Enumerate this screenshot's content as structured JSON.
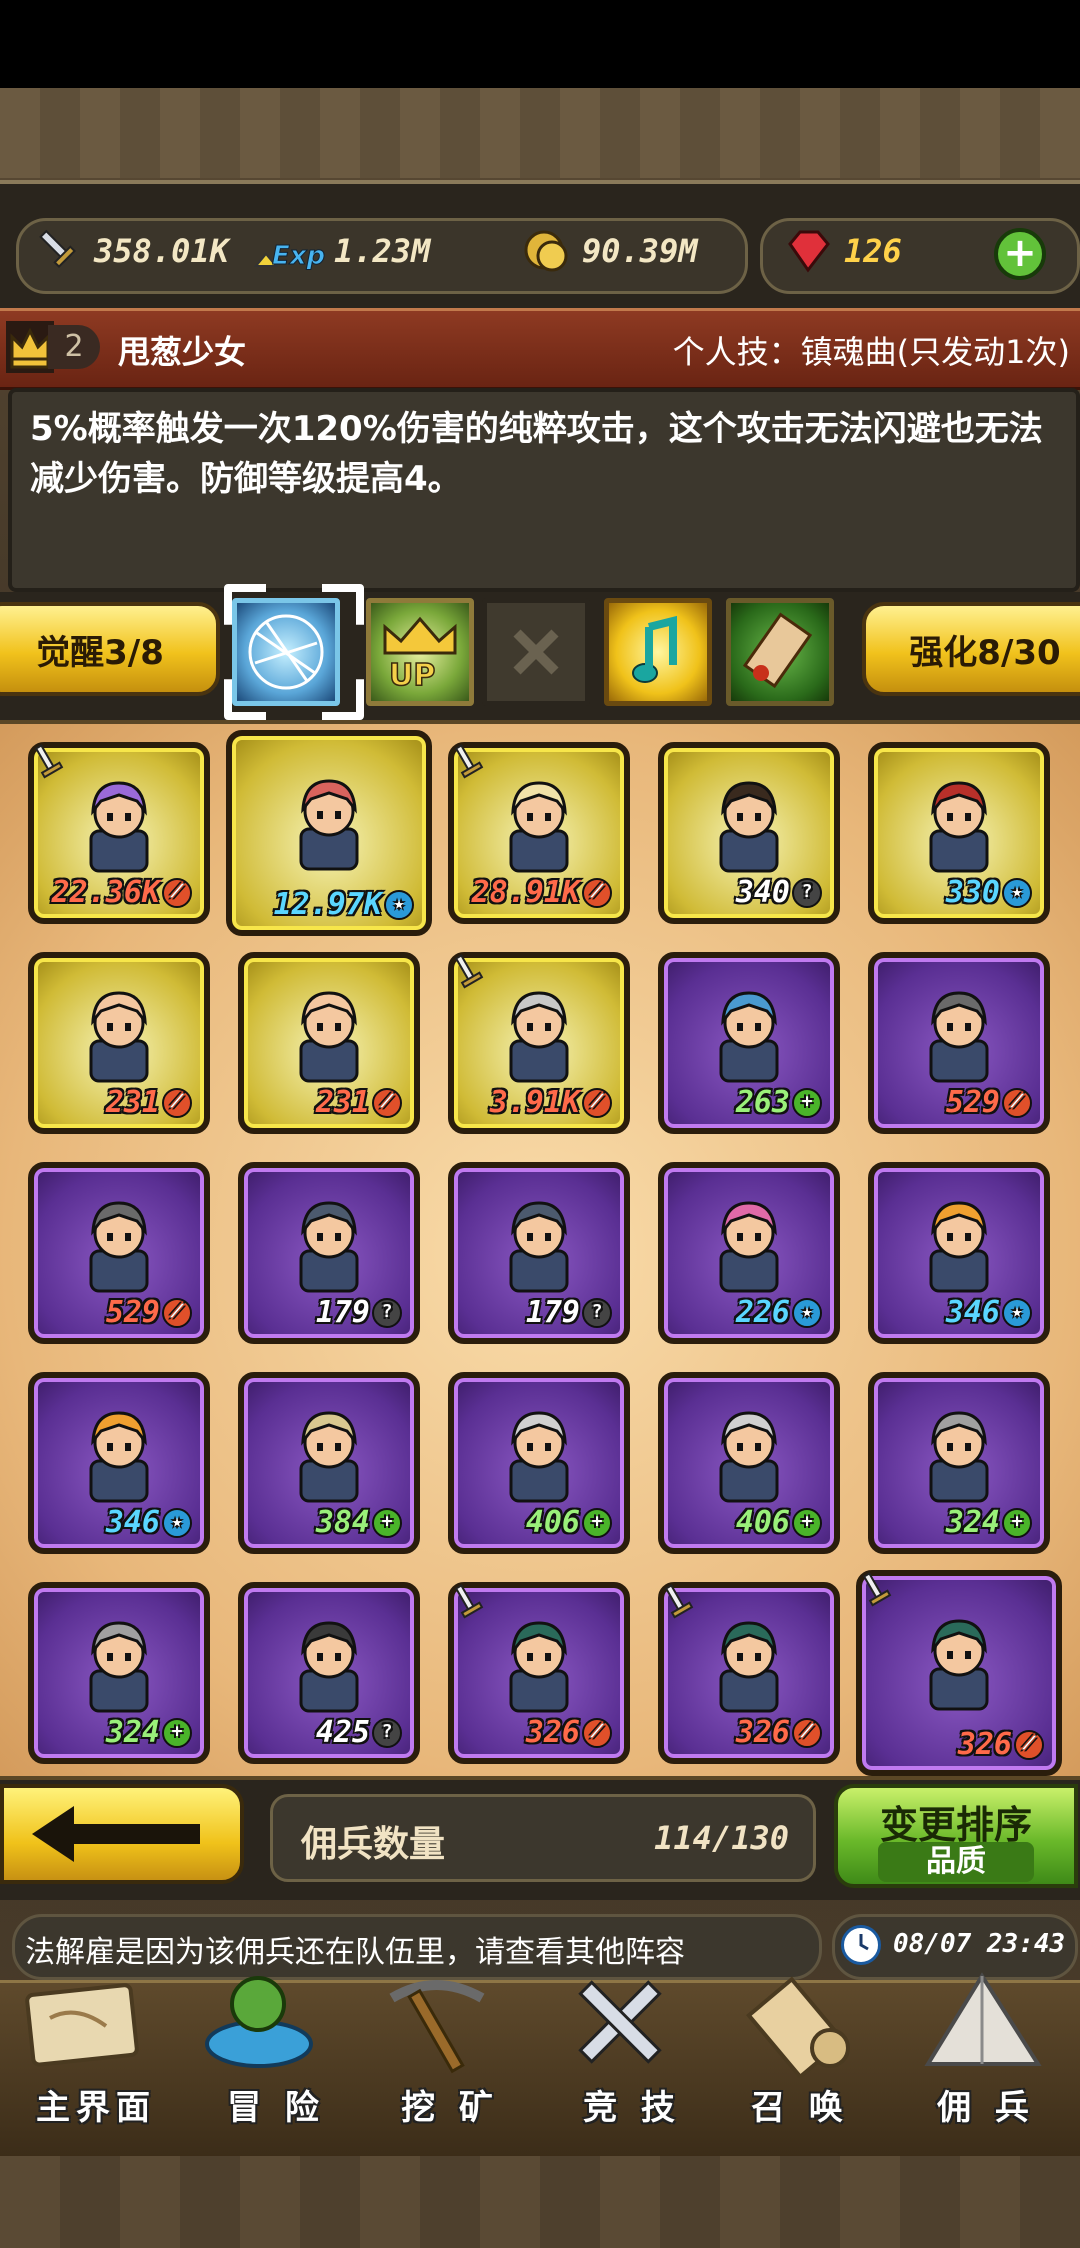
{
  "resources": {
    "attack": "358.01K",
    "exp": "1.23M",
    "gold": "90.39M",
    "gems": "126",
    "exp_badge": "Exp"
  },
  "hero": {
    "rank": "2",
    "name": "甩葱少女",
    "skill_title": "个人技：镇魂曲(只发动1次)",
    "description": "5%概率触发一次120%伤害的纯粹攻击，这个攻击无法闪避也无法减少伤害。防御等级提高4。"
  },
  "buttons": {
    "awaken": "觉醒3/8",
    "enhance": "强化8/30",
    "sort_label": "变更排序",
    "sort_value": "品质"
  },
  "mercenary_count": {
    "label": "佣兵数量",
    "value": "114/130"
  },
  "ticker": {
    "message": "法解雇是因为该佣兵还在队伍里，请查看其他阵容",
    "time": "08/07 23:43"
  },
  "nav": [
    "主界面",
    "冒 险",
    "挖 矿",
    "竞 技",
    "召 唤",
    "佣 兵"
  ],
  "cards": [
    {
      "level": "22.36K",
      "tier": "gold",
      "badge": "sword",
      "weapon": true,
      "color": "#ff6a4a",
      "hair": "#9a6ad8"
    },
    {
      "level": "12.97K",
      "tier": "gold",
      "badge": "star",
      "weapon": false,
      "color": "#5ad6ff",
      "hair": "#d9635d",
      "big": true
    },
    {
      "level": "28.91K",
      "tier": "gold",
      "badge": "sword",
      "weapon": true,
      "color": "#ff6a4a",
      "hair": "#f1e2a8"
    },
    {
      "level": "340",
      "tier": "gold",
      "badge": "question",
      "weapon": false,
      "color": "#ffffff",
      "hair": "#3a2a1e"
    },
    {
      "level": "330",
      "tier": "gold",
      "badge": "star",
      "weapon": false,
      "color": "#5ad6ff",
      "hair": "#b8302a"
    },
    {
      "level": "231",
      "tier": "gold",
      "badge": "sword",
      "weapon": false,
      "color": "#ff6a4a",
      "hair": "#f4c7a0"
    },
    {
      "level": "231",
      "tier": "gold",
      "badge": "sword",
      "weapon": false,
      "color": "#ff6a4a",
      "hair": "#f4c7a0"
    },
    {
      "level": "3.91K",
      "tier": "gold",
      "badge": "sword",
      "weapon": true,
      "color": "#ff6a4a",
      "hair": "#c8c8c8"
    },
    {
      "level": "263",
      "tier": "purple",
      "badge": "plus",
      "weapon": false,
      "color": "#9af07a",
      "hair": "#4a9ad0"
    },
    {
      "level": "529",
      "tier": "purple",
      "badge": "sword",
      "weapon": false,
      "color": "#ff6a4a",
      "hair": "#6a6a6a"
    },
    {
      "level": "529",
      "tier": "purple",
      "badge": "sword",
      "weapon": false,
      "color": "#ff6a4a",
      "hair": "#6a6a6a"
    },
    {
      "level": "179",
      "tier": "purple",
      "badge": "question",
      "weapon": false,
      "color": "#ffffff",
      "hair": "#4c5a6e"
    },
    {
      "level": "179",
      "tier": "purple",
      "badge": "question",
      "weapon": false,
      "color": "#ffffff",
      "hair": "#4c5a6e"
    },
    {
      "level": "226",
      "tier": "purple",
      "badge": "star",
      "weapon": false,
      "color": "#5ad6ff",
      "hair": "#e06aa8"
    },
    {
      "level": "346",
      "tier": "purple",
      "badge": "star",
      "weapon": false,
      "color": "#5ad6ff",
      "hair": "#f0a030"
    },
    {
      "level": "346",
      "tier": "purple",
      "badge": "star",
      "weapon": false,
      "color": "#5ad6ff",
      "hair": "#f0a030"
    },
    {
      "level": "384",
      "tier": "purple",
      "badge": "plus",
      "weapon": false,
      "color": "#9af07a",
      "hair": "#d8c890"
    },
    {
      "level": "406",
      "tier": "purple",
      "badge": "plus",
      "weapon": false,
      "color": "#9af07a",
      "hair": "#d0d0d0"
    },
    {
      "level": "406",
      "tier": "purple",
      "badge": "plus",
      "weapon": false,
      "color": "#9af07a",
      "hair": "#d0d0d0"
    },
    {
      "level": "324",
      "tier": "purple",
      "badge": "plus",
      "weapon": false,
      "color": "#9af07a",
      "hair": "#a0a0a0"
    },
    {
      "level": "324",
      "tier": "purple",
      "badge": "plus",
      "weapon": false,
      "color": "#9af07a",
      "hair": "#a0a0a0"
    },
    {
      "level": "425",
      "tier": "purple",
      "badge": "question",
      "weapon": false,
      "color": "#ffffff",
      "hair": "#3a3a3a"
    },
    {
      "level": "326",
      "tier": "purple",
      "badge": "sword",
      "weapon": true,
      "color": "#ff6a4a",
      "hair": "#2a6a5a"
    },
    {
      "level": "326",
      "tier": "purple",
      "badge": "sword",
      "weapon": true,
      "color": "#ff6a4a",
      "hair": "#2a6a5a"
    },
    {
      "level": "326",
      "tier": "purple",
      "badge": "sword",
      "weapon": true,
      "color": "#ff6a4a",
      "hair": "#2a6a5a",
      "big": true
    }
  ]
}
